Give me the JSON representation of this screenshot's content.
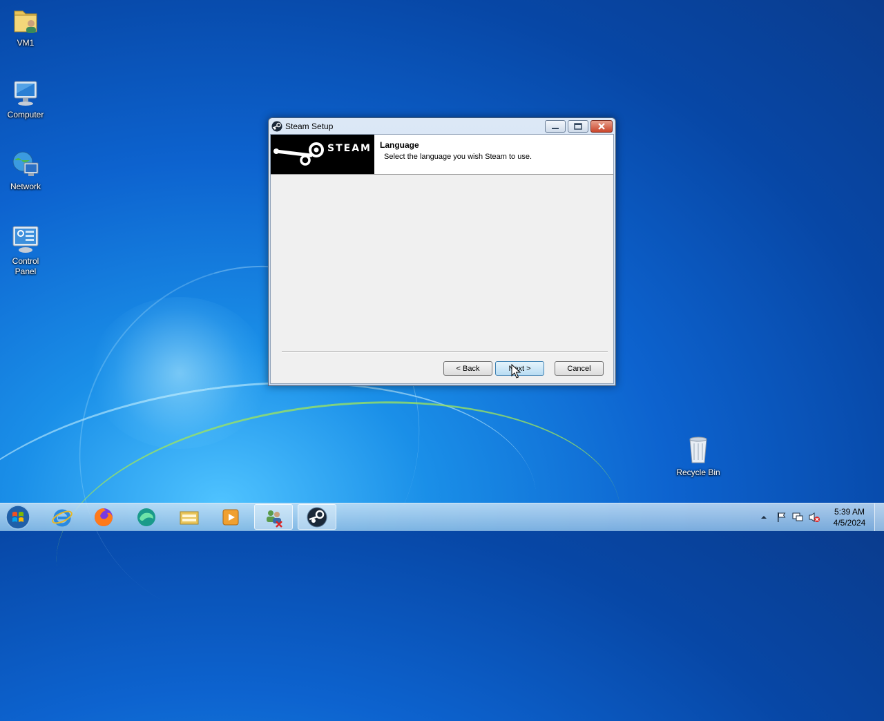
{
  "desktop": {
    "icons": [
      {
        "label": "VM1",
        "icon": "user-folder-icon"
      },
      {
        "label": "Computer",
        "icon": "computer-icon"
      },
      {
        "label": "Network",
        "icon": "network-icon"
      },
      {
        "label": "Control Panel",
        "icon": "control-panel-icon"
      },
      {
        "label": "Recycle Bin",
        "icon": "recycle-bin-icon"
      }
    ]
  },
  "dialog": {
    "title": "Steam Setup",
    "logo_text": "STEAM",
    "header_title": "Language",
    "header_subtitle": "Select the language you wish Steam to use.",
    "buttons": {
      "back": "< Back",
      "next": "Next >",
      "cancel": "Cancel"
    }
  },
  "taskbar": {
    "pinned": [
      "internet-explorer-icon",
      "firefox-icon",
      "browser-icon",
      "file-explorer-icon",
      "media-player-icon",
      "network-users-icon",
      "steam-icon"
    ],
    "clock_time": "5:39 AM",
    "clock_date": "4/5/2024"
  },
  "colors": {
    "desktop_blue": "#0d63cf",
    "dialog_frame": "#c7d8ee",
    "close_red": "#c9452b"
  }
}
